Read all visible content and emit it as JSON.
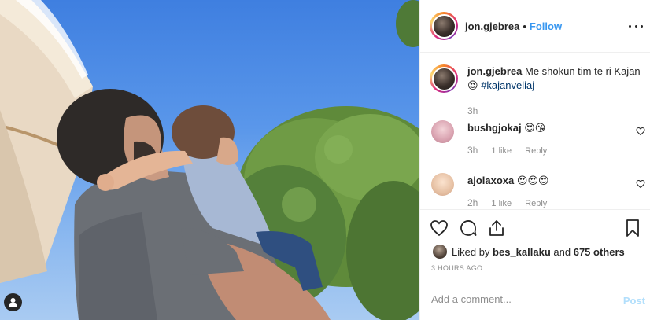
{
  "header": {
    "username": "jon.gjebrea",
    "separator": "•",
    "follow_label": "Follow"
  },
  "caption": {
    "username": "jon.gjebrea",
    "text": "Me shokun tim te ri Kajan",
    "emoji": "😍",
    "hashtag": "#kajanveliaj",
    "time": "3h"
  },
  "comments": [
    {
      "username": "bushgjokaj",
      "text": "😍😘",
      "time": "3h",
      "likes": "1 like",
      "reply": "Reply"
    },
    {
      "username": "ajolaxoxa",
      "text": "😍😍😍",
      "time": "2h",
      "likes": "1 like",
      "reply": "Reply"
    }
  ],
  "actions": {
    "like_icon": "heart-icon",
    "comment_icon": "comment-icon",
    "share_icon": "share-icon",
    "save_icon": "bookmark-icon"
  },
  "likes": {
    "prefix": "Liked by ",
    "user": "bes_kallaku",
    "middle": " and ",
    "others": "675 others"
  },
  "timestamp": "3 HOURS AGO",
  "composer": {
    "placeholder": "Add a comment...",
    "post_label": "Post"
  },
  "colors": {
    "link_blue": "#3897f0",
    "hashtag": "#003569",
    "post_disabled": "#b2dffc",
    "muted": "#8e8e8e"
  }
}
